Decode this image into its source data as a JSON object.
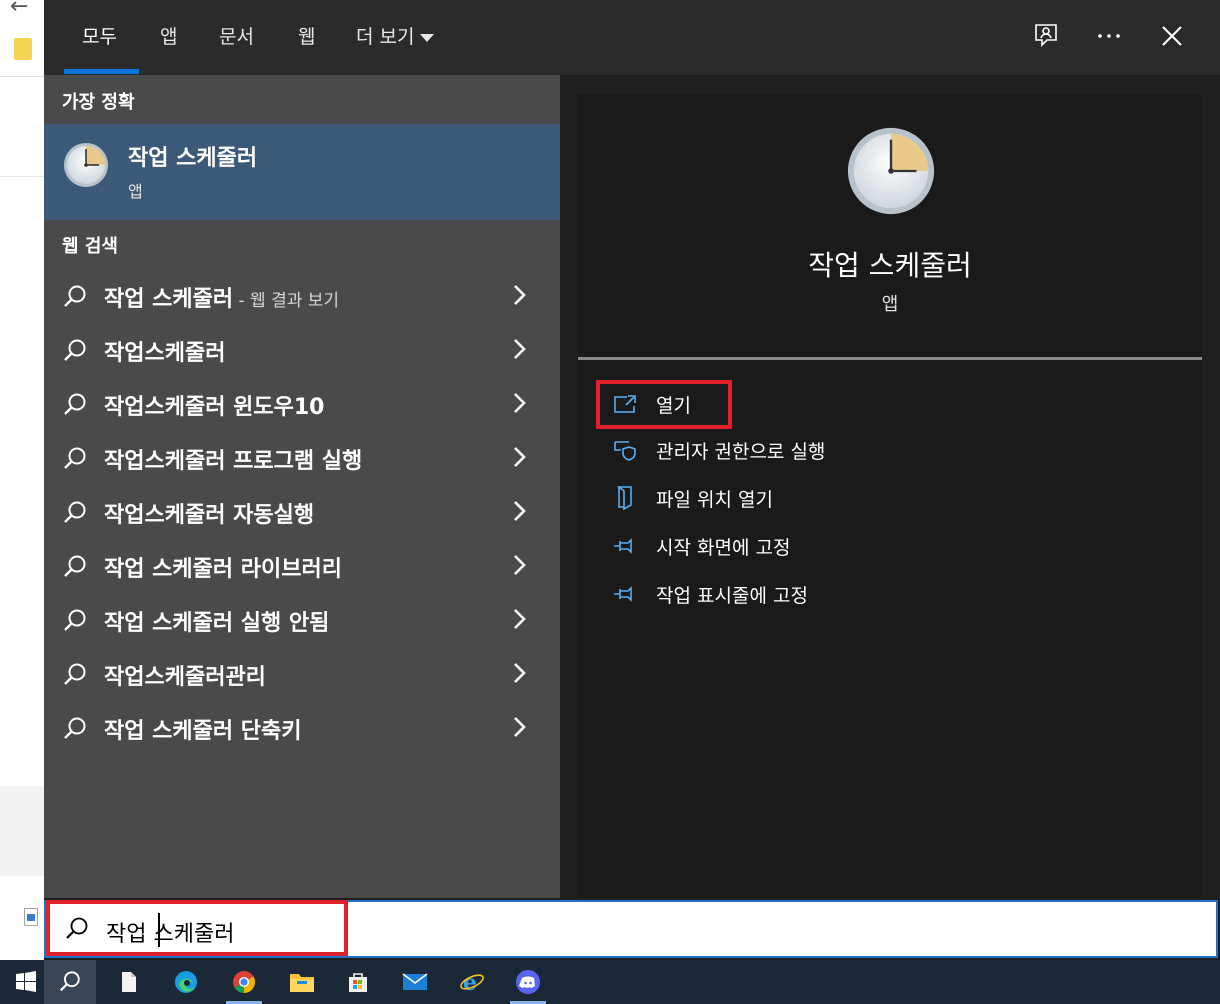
{
  "tabs": [
    {
      "label": "모두",
      "active": true
    },
    {
      "label": "앱"
    },
    {
      "label": "문서"
    },
    {
      "label": "웹"
    },
    {
      "label": "더 보기"
    }
  ],
  "top_icons": [
    "feedback-icon",
    "more-icon",
    "close-icon"
  ],
  "best_match": {
    "heading": "가장 정확",
    "title": "작업 스케줄러",
    "subtitle": "앱"
  },
  "web_search": {
    "heading": "웹 검색",
    "items": [
      {
        "label": "작업 스케줄러",
        "suffix": " - 웹 결과 보기"
      },
      {
        "label": "작업스케줄러",
        "suffix": ""
      },
      {
        "label": "작업스케줄러 윈도우10",
        "suffix": ""
      },
      {
        "label": "작업스케줄러 프로그램 실행",
        "suffix": ""
      },
      {
        "label": "작업스케줄러 자동실행",
        "suffix": ""
      },
      {
        "label": "작업 스케줄러 라이브러리",
        "suffix": ""
      },
      {
        "label": "작업 스케줄러 실행 안됨",
        "suffix": ""
      },
      {
        "label": "작업스케줄러관리",
        "suffix": ""
      },
      {
        "label": "작업 스케줄러 단축키",
        "suffix": ""
      }
    ]
  },
  "detail": {
    "title": "작업 스케줄러",
    "subtitle": "앱",
    "actions": [
      {
        "label": "열기",
        "icon": "open-icon"
      },
      {
        "label": "관리자 권한으로 실행",
        "icon": "shield-icon"
      },
      {
        "label": "파일 위치 열기",
        "icon": "file-location-icon"
      },
      {
        "label": "시작 화면에 고정",
        "icon": "pin-icon"
      },
      {
        "label": "작업 표시줄에 고정",
        "icon": "pin-icon"
      }
    ]
  },
  "search": {
    "value": "작업 스케줄러"
  },
  "taskbar": [
    "windows-start-icon",
    "search-icon",
    "file-icon",
    "edge-icon",
    "chrome-icon",
    "file-explorer-icon",
    "store-icon",
    "mail-icon",
    "internet-explorer-icon",
    "discord-icon"
  ],
  "colors": {
    "accent": "#0a74da",
    "highlight_box": "#e0202a",
    "best_match_bg": "#3c5a78",
    "action_icon": "#5aaef0"
  }
}
